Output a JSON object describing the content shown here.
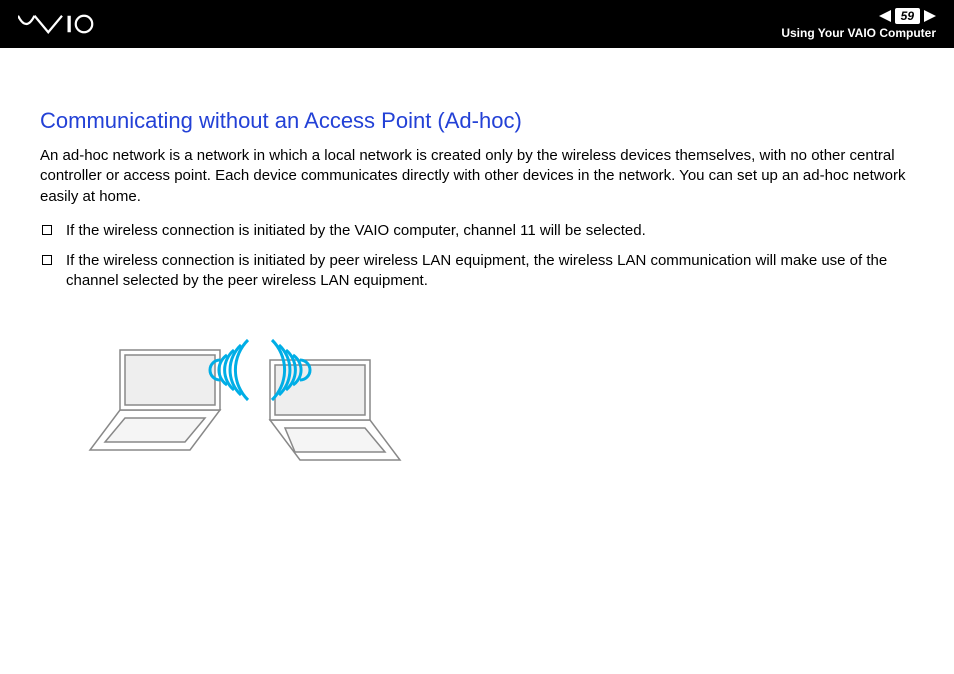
{
  "header": {
    "page_number": "59",
    "section": "Using Your VAIO Computer"
  },
  "content": {
    "title": "Communicating without an Access Point (Ad-hoc)",
    "intro": "An ad-hoc network is a network in which a local network is created only by the wireless devices themselves, with no other central controller or access point. Each device communicates directly with other devices in the network. You can set up an ad-hoc network easily at home.",
    "bullets": [
      "If the wireless connection is initiated by the VAIO computer, channel 11 will be selected.",
      "If the wireless connection is initiated by peer wireless LAN equipment, the wireless LAN communication will make use of the channel selected by the peer wireless LAN equipment."
    ]
  }
}
